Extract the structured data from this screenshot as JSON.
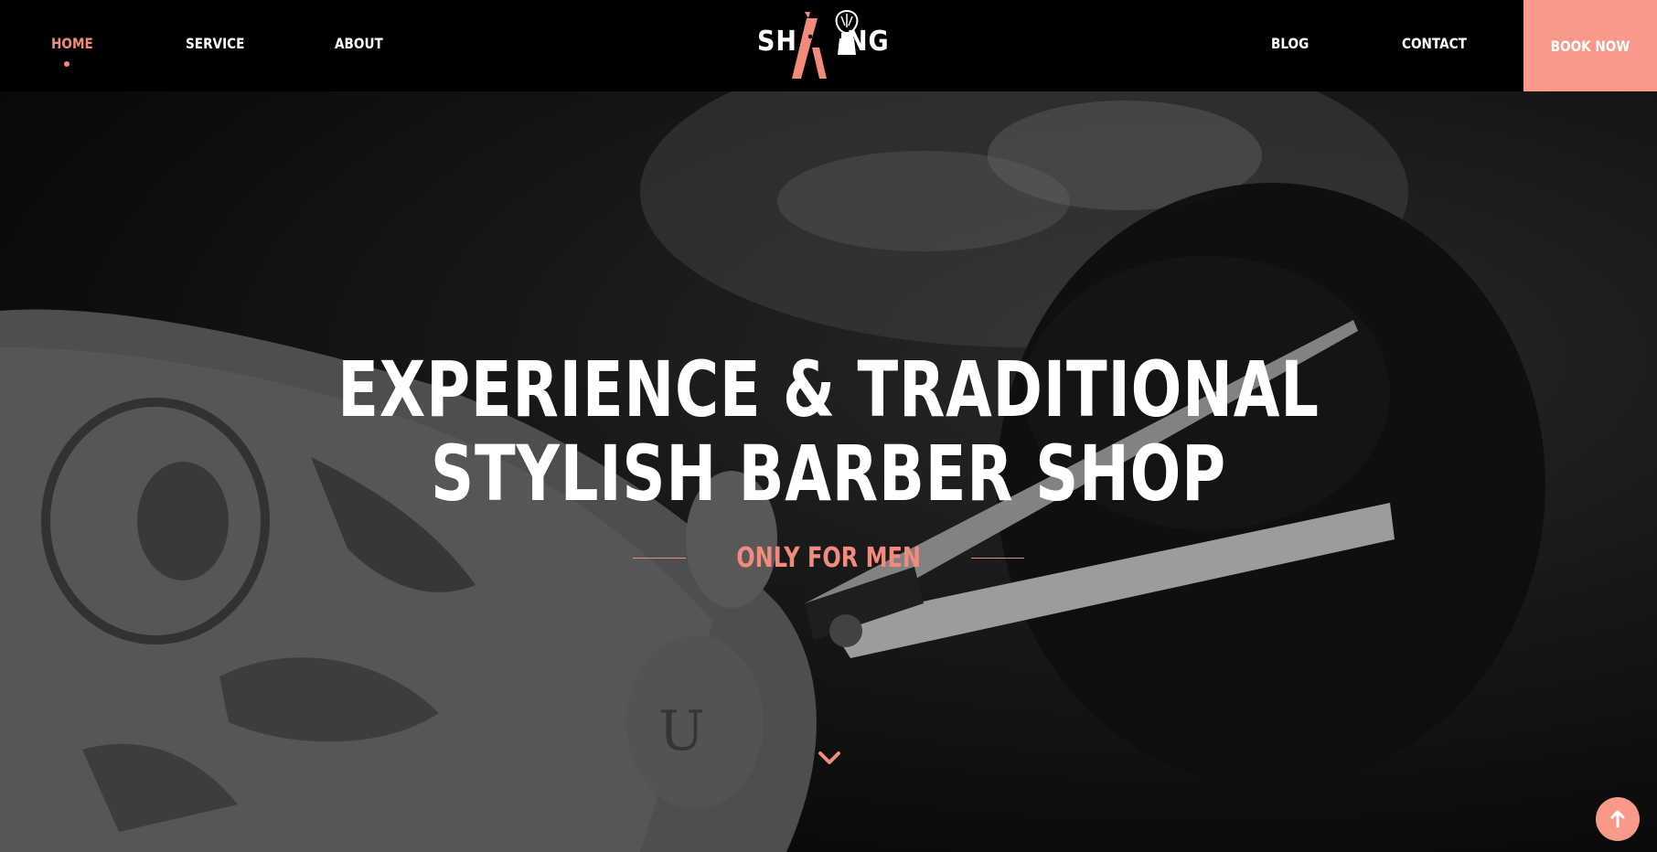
{
  "nav": {
    "left": [
      {
        "label": "HOME",
        "active": true
      },
      {
        "label": "SERVICE",
        "active": false
      },
      {
        "label": "ABOUT",
        "active": false
      }
    ],
    "right": [
      {
        "label": "BLOG"
      },
      {
        "label": "CONTACT"
      }
    ],
    "book_label": "BOOK NOW"
  },
  "logo": {
    "text_left": "SH",
    "text_right": "NG",
    "icon": "razor-and-shaving-brush-icon"
  },
  "hero": {
    "title_line1": "EXPERIENCE & TRADITIONAL",
    "title_line2": "STYLISH BARBER SHOP",
    "subtitle": "ONLY FOR MEN"
  },
  "icons": {
    "scroll": "chevron-down-icon",
    "back_to_top": "arrow-up-icon"
  },
  "colors": {
    "accent": "#f38b7c",
    "button": "#f8998a",
    "header": "#000000",
    "text": "#ffffff"
  }
}
